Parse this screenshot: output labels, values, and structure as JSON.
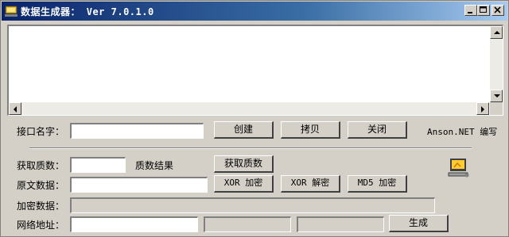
{
  "window": {
    "title": "数据生成器： Ver 7.0.1.0",
    "controls": {
      "minimize": "minimize-icon",
      "maximize": "maximize-icon",
      "close": "close-icon"
    }
  },
  "output": {
    "value": ""
  },
  "row_interface": {
    "label": "接口名字：",
    "input_value": "",
    "create_button": "创建",
    "copy_button": "拷贝",
    "close_button": "关闭",
    "author": "Anson.NET 编写"
  },
  "row_prime": {
    "label": "获取质数：",
    "input_value": "",
    "result_label": "质数结果",
    "get_button": "获取质数"
  },
  "row_plain": {
    "label": "原文数据：",
    "input_value": "",
    "xor_encrypt_button": "XOR 加密",
    "xor_decrypt_button": "XOR 解密",
    "md5_button": "MD5 加密"
  },
  "row_encrypted": {
    "label": "加密数据：",
    "value": ""
  },
  "row_url": {
    "label": "网络地址：",
    "input_value": "",
    "field2_value": "",
    "field3_value": "",
    "generate_button": "生成"
  },
  "colors": {
    "title_gradient_start": "#0a246a",
    "title_gradient_end": "#a6caf0",
    "face": "#d4d0c8"
  }
}
